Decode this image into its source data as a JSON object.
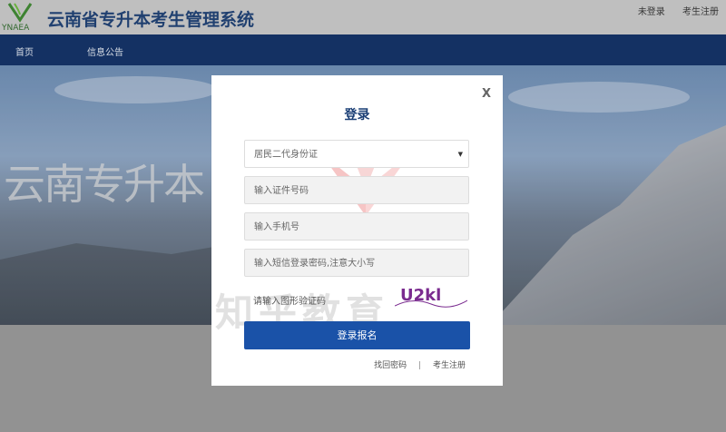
{
  "header": {
    "logo_text": "YNAEA",
    "title": "云南省专升本考生管理系统",
    "links": [
      "未登录",
      "考生注册"
    ]
  },
  "nav": {
    "items": [
      "首页",
      "信息公告"
    ]
  },
  "banner": {
    "calligraphy": "云南专升本"
  },
  "modal": {
    "close": "X",
    "title": "登录",
    "id_type": "居民二代身份证",
    "id_number_placeholder": "输入证件号码",
    "phone_placeholder": "输入手机号",
    "sms_placeholder": "输入短信登录密码,注意大小写",
    "captcha_placeholder": "请输入图形验证码",
    "captcha_text": "U2kl",
    "submit": "登录报名",
    "links": [
      "找回密码",
      "|",
      "考生注册"
    ]
  },
  "watermark": {
    "text": "知乎教育"
  },
  "colors": {
    "nav_bg": "#0c2d66",
    "title": "#1a3e75",
    "button": "#1a52a8"
  }
}
